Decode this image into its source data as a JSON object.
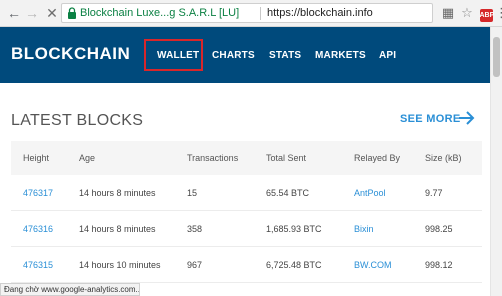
{
  "browser": {
    "site_identity": "Blockchain Luxe...g S.A.R.L [LU]",
    "url": "https://blockchain.info",
    "extension_badge": "ABP",
    "status_text": "Đang chờ www.google-analytics.com..."
  },
  "header": {
    "logo": "BLOCKCHAIN",
    "nav": [
      "WALLET",
      "CHARTS",
      "STATS",
      "MARKETS",
      "API"
    ]
  },
  "main": {
    "title": "LATEST BLOCKS",
    "see_more": "SEE MORE",
    "columns": [
      "Height",
      "Age",
      "Transactions",
      "Total Sent",
      "Relayed By",
      "Size (kB)"
    ],
    "rows": [
      {
        "height": "476317",
        "age": "14 hours 8 minutes",
        "transactions": "15",
        "total_sent": "65.54 BTC",
        "relayed_by": "AntPool",
        "size": "9.77"
      },
      {
        "height": "476316",
        "age": "14 hours 8 minutes",
        "transactions": "358",
        "total_sent": "1,685.93 BTC",
        "relayed_by": "Bixin",
        "size": "998.25"
      },
      {
        "height": "476315",
        "age": "14 hours 10 minutes",
        "transactions": "967",
        "total_sent": "6,725.48 BTC",
        "relayed_by": "BW.COM",
        "size": "998.12"
      }
    ]
  },
  "colors": {
    "header_bg": "#004a7c",
    "link": "#2a8fd6",
    "highlight_border": "#d9262a"
  }
}
